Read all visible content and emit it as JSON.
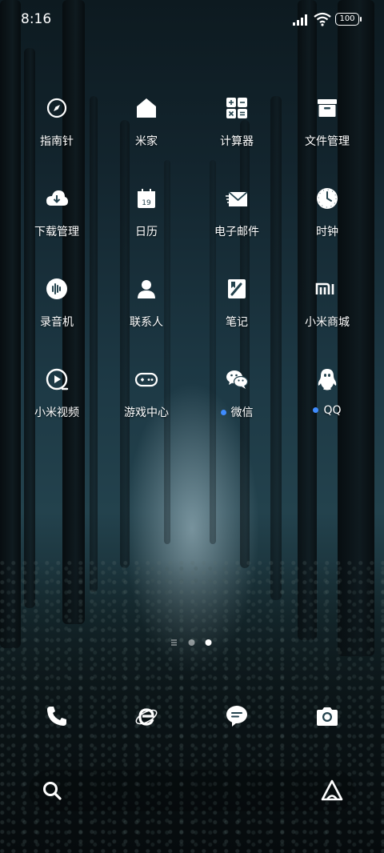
{
  "status": {
    "time": "8:16",
    "battery": "100"
  },
  "apps": [
    {
      "label": "指南针"
    },
    {
      "label": "米家"
    },
    {
      "label": "计算器"
    },
    {
      "label": "文件管理"
    },
    {
      "label": "下载管理"
    },
    {
      "label": "日历",
      "calendar_day": "19"
    },
    {
      "label": "电子邮件"
    },
    {
      "label": "时钟"
    },
    {
      "label": "录音机"
    },
    {
      "label": "联系人"
    },
    {
      "label": "笔记"
    },
    {
      "label": "小米商城"
    },
    {
      "label": "小米视频"
    },
    {
      "label": "游戏中心"
    },
    {
      "label": "微信",
      "new": true
    },
    {
      "label": "QQ",
      "new": true
    }
  ],
  "dock": [
    "phone-icon",
    "browser-icon",
    "messages-icon",
    "camera-icon"
  ],
  "page_indicator": {
    "pages": 2,
    "current": 2
  },
  "colors": {
    "new_dot": "#3f8cff"
  }
}
